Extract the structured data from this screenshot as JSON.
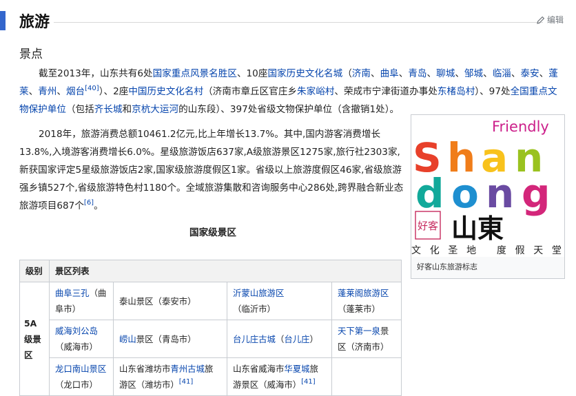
{
  "section": {
    "title": "旅游",
    "edit_label": "编辑"
  },
  "subsection": {
    "title": "景点"
  },
  "para1": {
    "t01": "截至2013年，山东共有6处",
    "l01": "国家重点风景名胜区",
    "t02": "、10座",
    "l02": "国家历史文化名城",
    "t03": "（",
    "l03": "济南",
    "t04": "、",
    "l04": "曲阜",
    "t05": "、",
    "l05": "青岛",
    "t06": "、",
    "l06": "聊城",
    "t07": "、",
    "l07": "邹城",
    "t08": "、",
    "l08": "临淄",
    "t09": "、",
    "l09": "泰安",
    "t10": "、",
    "l10": "蓬莱",
    "t11": "、",
    "l11": "青州",
    "t12": "、",
    "l12": "烟台",
    "ref": "[40]",
    "t13": "）、2座",
    "l13": "中国历史文化名村",
    "t14": "（济南市章丘区官庄乡",
    "l14": "朱家峪村",
    "t15": "、荣成市宁津街道办事处",
    "l15": "东楮岛村",
    "t16": "）、97处",
    "l16": "全国重点文物保护单位",
    "t17": "（包括",
    "l17": "齐长城",
    "t18": "和",
    "l18": "京杭大运河",
    "t19": "的山东段）、397处省级文物保护单位（含撤销1处）。"
  },
  "para2": {
    "text": "2018年，旅游消费总额10461.2亿元,比上年增长13.7%。其中,国内游客消费增长13.8%,入境游客消费增长6.0%。星级旅游饭店637家,A级旅游景区1275家,旅行社2303家,新获国家评定5星级旅游饭店2家,国家级旅游度假区1家。省级以上旅游度假区46家,省级旅游强乡镇527个,省级旅游特色村1180个。全域旅游集散和咨询服务中心286处,跨界融合新业态旅游项目687个",
    "ref": "[6]",
    "end": "。"
  },
  "infobox": {
    "friendly": "Friendly",
    "shan": [
      "S",
      "h",
      "a",
      "n"
    ],
    "dong": [
      "d",
      "o",
      "n",
      "g"
    ],
    "seal": "好客",
    "chinese": "山東",
    "slogan": "文化圣地 度假天堂",
    "caption": "好客山东旅游标志"
  },
  "table": {
    "title": "国家级景区",
    "header_level": "级别",
    "header_list": "景区列表",
    "level": "5A级景区",
    "rows": [
      [
        {
          "link": "曲阜三孔",
          "rest": "（曲阜市）"
        },
        {
          "text": "泰山景区（泰安市）"
        },
        {
          "link": "沂蒙山旅游区",
          "rest": "（临沂市）"
        },
        {
          "link": "蓬莱阁旅游区",
          "rest": "（蓬莱市）"
        }
      ],
      [
        {
          "link": "威海刘公岛",
          "rest": "（威海市）"
        },
        {
          "link": "崂山",
          "rest": "景区（青岛市）"
        },
        {
          "link": "台儿庄古城",
          "rest": "（",
          "link2": "台儿庄",
          "rest2": "）"
        },
        {
          "link": "天下第一泉",
          "rest": "景区（济南市）"
        }
      ],
      [
        {
          "link": "龙口南山景区",
          "rest": "（龙口市）"
        },
        {
          "pre": "山东省潍坊市",
          "link": "青州古城",
          "rest": "旅游区（潍坊市）",
          "ref": "[41]"
        },
        {
          "pre": "山东省威海市",
          "link": "华夏城",
          "rest": "旅游景区（威海市）",
          "ref": "[41]"
        },
        {}
      ]
    ]
  },
  "colors": {
    "link": "#0645ad",
    "bar": "#3366cc",
    "friendly": "#cc1f8a",
    "S": "#e8402a",
    "h": "#f07d1a",
    "a": "#f8c21c",
    "n": "#9ac21f",
    "d": "#12a99a",
    "o": "#1e8fd0",
    "n2": "#6a4ba2",
    "g": "#d3267a"
  }
}
